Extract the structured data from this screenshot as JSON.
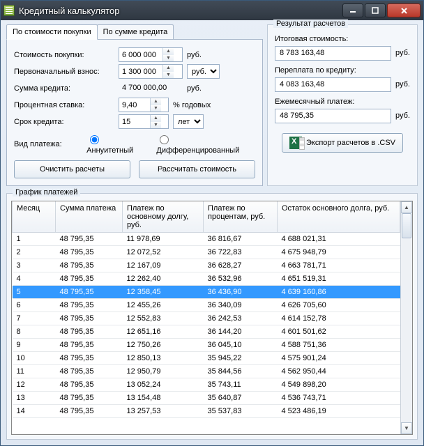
{
  "window": {
    "title": "Кредитный калькулятор"
  },
  "tabs": {
    "by_price": "По стоимости покупки",
    "by_sum": "По сумме кредита"
  },
  "inputs": {
    "price_label": "Стоимость покупки:",
    "price_value": "6 000 000",
    "price_unit": "руб.",
    "downpayment_label": "Первоначальный взнос:",
    "downpayment_value": "1 300 000",
    "downpayment_unit": "руб.",
    "credit_sum_label": "Сумма кредита:",
    "credit_sum_value": "4 700 000,00",
    "credit_sum_unit": "руб.",
    "rate_label": "Процентная ставка:",
    "rate_value": "9,40",
    "rate_unit": "% годовых",
    "term_label": "Срок кредита:",
    "term_value": "15",
    "term_unit": "лет",
    "payment_type_label": "Вид платежа:",
    "annuity_label": "Аннуитетный",
    "diff_label": "Дифференцированный"
  },
  "buttons": {
    "clear": "Очистить расчеты",
    "calc": "Рассчитать стоимость",
    "export": "Экспорт расчетов в .CSV"
  },
  "results": {
    "group_label": "Результат расчетов",
    "total_label": "Итоговая стоимость:",
    "total_value": "8 783 163,48",
    "overpay_label": "Переплата по кредиту:",
    "overpay_value": "4 083 163,48",
    "monthly_label": "Ежемесячный платеж:",
    "monthly_value": "48 795,35",
    "unit": "руб."
  },
  "schedule": {
    "group_label": "График платежей",
    "columns": {
      "month": "Месяц",
      "total": "Сумма платежа",
      "principal": "Платеж по основному долгу, руб.",
      "interest": "Платеж по процентам, руб.",
      "balance": "Остаток основного долга, руб."
    },
    "selected_index": 4,
    "rows": [
      {
        "m": "1",
        "t": "48 795,35",
        "p": "11 978,69",
        "i": "36 816,67",
        "b": "4 688 021,31"
      },
      {
        "m": "2",
        "t": "48 795,35",
        "p": "12 072,52",
        "i": "36 722,83",
        "b": "4 675 948,79"
      },
      {
        "m": "3",
        "t": "48 795,35",
        "p": "12 167,09",
        "i": "36 628,27",
        "b": "4 663 781,71"
      },
      {
        "m": "4",
        "t": "48 795,35",
        "p": "12 262,40",
        "i": "36 532,96",
        "b": "4 651 519,31"
      },
      {
        "m": "5",
        "t": "48 795,35",
        "p": "12 358,45",
        "i": "36 436,90",
        "b": "4 639 160,86"
      },
      {
        "m": "6",
        "t": "48 795,35",
        "p": "12 455,26",
        "i": "36 340,09",
        "b": "4 626 705,60"
      },
      {
        "m": "7",
        "t": "48 795,35",
        "p": "12 552,83",
        "i": "36 242,53",
        "b": "4 614 152,78"
      },
      {
        "m": "8",
        "t": "48 795,35",
        "p": "12 651,16",
        "i": "36 144,20",
        "b": "4 601 501,62"
      },
      {
        "m": "9",
        "t": "48 795,35",
        "p": "12 750,26",
        "i": "36 045,10",
        "b": "4 588 751,36"
      },
      {
        "m": "10",
        "t": "48 795,35",
        "p": "12 850,13",
        "i": "35 945,22",
        "b": "4 575 901,24"
      },
      {
        "m": "11",
        "t": "48 795,35",
        "p": "12 950,79",
        "i": "35 844,56",
        "b": "4 562 950,44"
      },
      {
        "m": "12",
        "t": "48 795,35",
        "p": "13 052,24",
        "i": "35 743,11",
        "b": "4 549 898,20"
      },
      {
        "m": "13",
        "t": "48 795,35",
        "p": "13 154,48",
        "i": "35 640,87",
        "b": "4 536 743,71"
      },
      {
        "m": "14",
        "t": "48 795,35",
        "p": "13 257,53",
        "i": "35 537,83",
        "b": "4 523 486,19"
      }
    ]
  }
}
